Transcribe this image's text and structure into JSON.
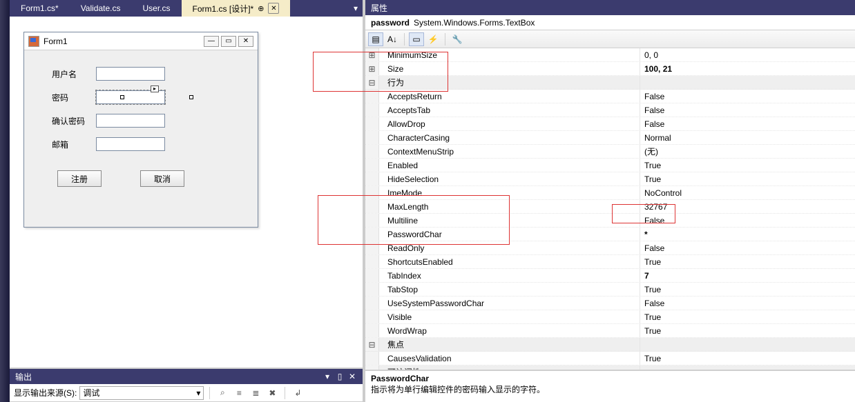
{
  "tabs": [
    {
      "label": "Form1.cs*"
    },
    {
      "label": "Validate.cs"
    },
    {
      "label": "User.cs"
    },
    {
      "label": "Form1.cs [设计]*"
    }
  ],
  "form": {
    "title": "Form1",
    "labels": {
      "username": "用户名",
      "password": "密码",
      "confirm": "确认密码",
      "email": "邮箱"
    },
    "buttons": {
      "register": "注册",
      "cancel": "取消"
    }
  },
  "output": {
    "title": "输出",
    "source_label": "显示输出来源(S):",
    "source_value": "调试"
  },
  "properties": {
    "title": "属性",
    "object_name": "password",
    "object_type": "System.Windows.Forms.TextBox",
    "rows": [
      {
        "gutter": "⊞",
        "name": "MinimumSize",
        "value": "0, 0"
      },
      {
        "gutter": "⊞",
        "name": "Size",
        "value": "100, 21",
        "bold": true
      },
      {
        "gutter": "⊟",
        "name": "行为",
        "cat": true
      },
      {
        "name": "AcceptsReturn",
        "value": "False"
      },
      {
        "name": "AcceptsTab",
        "value": "False"
      },
      {
        "name": "AllowDrop",
        "value": "False"
      },
      {
        "name": "CharacterCasing",
        "value": "Normal"
      },
      {
        "name": "ContextMenuStrip",
        "value": "(无)"
      },
      {
        "name": "Enabled",
        "value": "True"
      },
      {
        "name": "HideSelection",
        "value": "True"
      },
      {
        "name": "ImeMode",
        "value": "NoControl"
      },
      {
        "name": "MaxLength",
        "value": "32767"
      },
      {
        "name": "Multiline",
        "value": "False"
      },
      {
        "name": "PasswordChar",
        "value": "*",
        "bold": true
      },
      {
        "name": "ReadOnly",
        "value": "False"
      },
      {
        "name": "ShortcutsEnabled",
        "value": "True"
      },
      {
        "name": "TabIndex",
        "value": "7",
        "bold": true
      },
      {
        "name": "TabStop",
        "value": "True"
      },
      {
        "name": "UseSystemPasswordChar",
        "value": "False"
      },
      {
        "name": "Visible",
        "value": "True"
      },
      {
        "name": "WordWrap",
        "value": "True"
      },
      {
        "gutter": "⊟",
        "name": "焦点",
        "cat": true
      },
      {
        "name": "CausesValidation",
        "value": "True"
      },
      {
        "gutter": "⊟",
        "name": "可访问性",
        "cat": true
      }
    ],
    "desc_title": "PasswordChar",
    "desc_text": "指示将为单行编辑控件的密码输入显示的字符。"
  }
}
